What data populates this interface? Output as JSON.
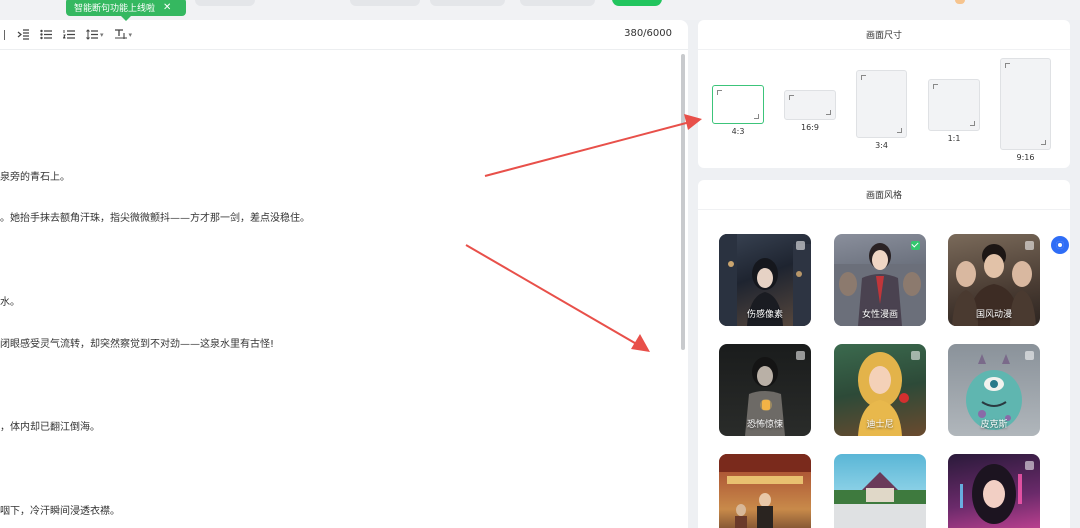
{
  "toast": {
    "text": "智能断句功能上线啦",
    "close": "✕"
  },
  "editor": {
    "counter": "380/6000",
    "lines": [
      "泉旁的青石上。",
      "。她抬手抹去额角汗珠，指尖微微颤抖——方才那一剑，差点没稳住。",
      "水。",
      "闭眼感受灵气流转，却突然察觉到不对劲——这泉水里有古怪!",
      "，体内却已翻江倒海。",
      "咽下，冷汗瞬间浸透衣襟。"
    ]
  },
  "size_panel": {
    "title": "画面尺寸",
    "selected": "4:3",
    "options": [
      {
        "label": "4:3"
      },
      {
        "label": "16:9"
      },
      {
        "label": "3:4"
      },
      {
        "label": "1:1"
      },
      {
        "label": "9:16"
      }
    ]
  },
  "style_panel": {
    "title": "画面风格",
    "selected": "女性漫画",
    "items": [
      {
        "label": "伤感像素",
        "checked": false,
        "thumb": "dark-street-anime-woman"
      },
      {
        "label": "女性漫画",
        "checked": true,
        "thumb": "anime-man-in-suit"
      },
      {
        "label": "国风动漫",
        "checked": false,
        "thumb": "chinese-anime-men"
      },
      {
        "label": "恐怖惊悚",
        "checked": false,
        "thumb": "dark-woman-with-lantern"
      },
      {
        "label": "迪士尼",
        "checked": false,
        "thumb": "disney-princess"
      },
      {
        "label": "皮克斯",
        "checked": false,
        "thumb": "pixar-monster"
      },
      {
        "label": "",
        "checked": false,
        "thumb": "vintage-street-scene"
      },
      {
        "label": "",
        "checked": false,
        "thumb": "countryside-house"
      },
      {
        "label": "",
        "checked": false,
        "thumb": "neon-anime-woman"
      }
    ]
  },
  "colors": {
    "accent": "#35b860",
    "arrow": "#e8504a",
    "float_button": "#2f6df6"
  }
}
